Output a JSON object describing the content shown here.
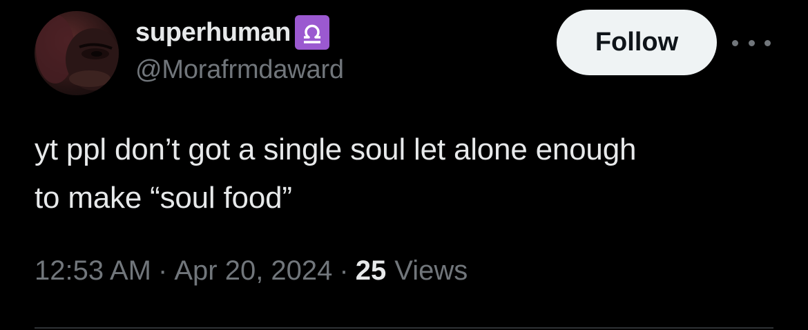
{
  "tweet": {
    "author": {
      "display_name": "superhuman",
      "badge_emoji": "libra-icon",
      "handle": "@Morafrmdaward"
    },
    "follow_label": "Follow",
    "more_icon": "more-horizontal-icon",
    "text_line1": "yt ppl don’t got a single soul let alone enough",
    "text_line2": "to make “soul food”",
    "time": "12:53 AM",
    "separator": "·",
    "date": "Apr 20, 2024",
    "views_count": "25",
    "views_label": "Views"
  },
  "colors": {
    "background": "#000000",
    "primary_text": "#e7e9ea",
    "secondary_text": "#71767b",
    "follow_button_bg": "#eff3f4",
    "badge_purple": "#9b59d0",
    "divider": "#2f3336"
  }
}
